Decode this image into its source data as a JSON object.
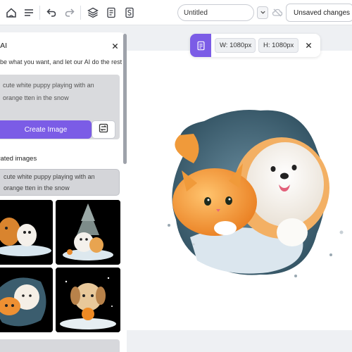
{
  "toolbar": {
    "icons": [
      "home-icon",
      "menu-icon",
      "undo-icon",
      "redo-icon",
      "layers-icon",
      "document-icon",
      "dollar-document-icon"
    ],
    "title_value": "Untitled",
    "save_status": "Unsaved changes"
  },
  "sizebar": {
    "icon": "document-icon",
    "width_label": "W: 1080px",
    "height_label": "H: 1080px"
  },
  "panel": {
    "title": "rk AI",
    "description": "ribe what you want, and let our AI do the rest",
    "prompt_text": "cute white puppy playing with an orange tten in the snow",
    "create_label": "Create Image",
    "section_title": "erated images",
    "history": [
      "cute white puppy playing with an orange tten in the snow"
    ]
  },
  "colors": {
    "accent": "#7b5ce6",
    "panel_bg": "#ffffff",
    "canvas_bg": "#eef0f3"
  }
}
